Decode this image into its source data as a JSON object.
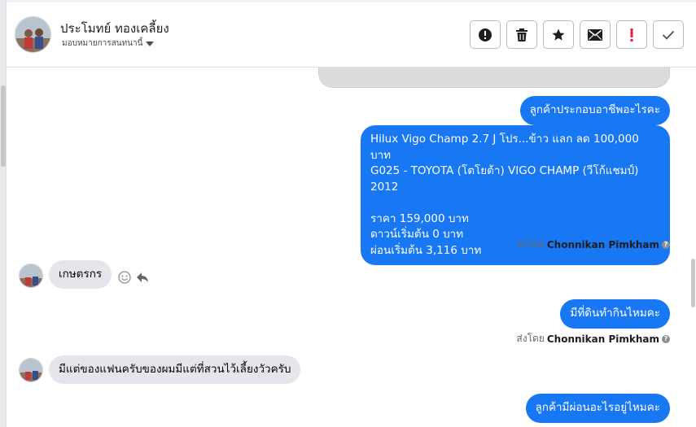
{
  "header": {
    "contact_name": "ประโมทย์ ทองเคลี้ยง",
    "assign_label": "มอบหมายการสนทนานี้"
  },
  "actions": [
    {
      "name": "spam-button",
      "icon": "alert-circle-icon"
    },
    {
      "name": "delete-button",
      "icon": "trash-icon"
    },
    {
      "name": "star-button",
      "icon": "star-icon"
    },
    {
      "name": "mark-unread-button",
      "icon": "envelope-icon"
    },
    {
      "name": "mark-important-button",
      "icon": "exclamation-icon",
      "color": "#e41e3f"
    },
    {
      "name": "mark-done-button",
      "icon": "check-icon"
    }
  ],
  "messages": {
    "m1": "ลูกค้าประกอบอาชีพอะไรคะ",
    "m2": "Hilux Vigo Champ 2.7 J โปร...ข้าว แลก ลด 100,000 บาท\nG025 - TOYOTA (โตโยต้า) VIGO CHAMP (วีโก้แชมป์) 2012\n\nราคา 159,000 บาท\nดาวน์เริ่มต้น 0 บาท\nผ่อนเริ่มต้น 3,116 บาท",
    "sent_by_prefix": "ส่งโดย",
    "sent_by_name": "Chonnikan Pimkham",
    "in1": "เกษตรกร",
    "m3": "มีที่ดินทำกินไหมคะ",
    "in2": "มีแต่ของแฟนครับของผมมีแต่ที่สวนไว้เลี้ยงวัวครับ",
    "m4": "ลูกค้ามีผ่อนอะไรอยู่ไหมคะ"
  },
  "colors": {
    "outgoing_bubble": "#1877f2",
    "incoming_bubble": "#e4e6eb",
    "important_red": "#e41e3f"
  }
}
